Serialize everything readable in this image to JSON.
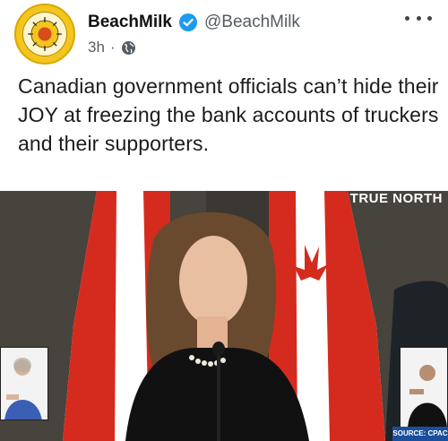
{
  "post": {
    "author": {
      "display_name": "BeachMilk",
      "handle": "@BeachMilk",
      "verified": true,
      "avatar_icon": "sun-seal-logo-icon"
    },
    "meta": {
      "time": "3h",
      "separator": "·",
      "visibility_icon": "globe-icon"
    },
    "more_icon": "more-horizontal-icon",
    "text": "Canadian government officials can’t hide their JOY at freezing the bank accounts of truckers and their supporters."
  },
  "media": {
    "type": "video-still",
    "watermark": "TRUE NORTH",
    "source_badge": "SOURCE: CPAC",
    "colors": {
      "flag_red": "#d52b1e",
      "verified_blue": "#1d9bf0",
      "avatar_gold": "#f4c51e"
    }
  }
}
